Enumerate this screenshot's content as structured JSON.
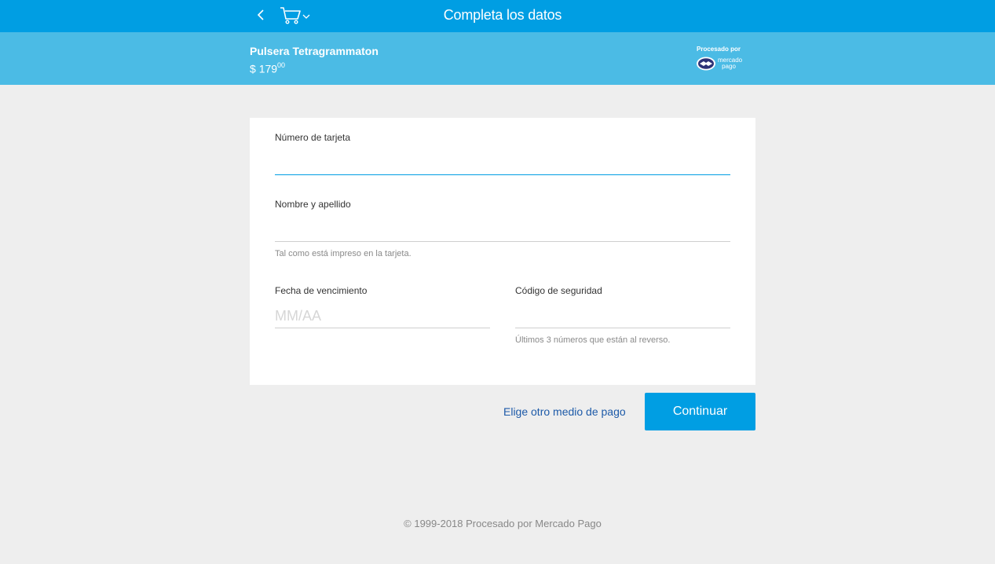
{
  "header": {
    "title": "Completa los datos",
    "back_icon": "chevron-left-icon",
    "cart_icon": "cart-icon",
    "background": "#009ee3"
  },
  "summary": {
    "product_name": "Pulsera Tetragrammaton",
    "price_symbol": "$",
    "price_integer": "179",
    "price_cents": "00",
    "processed_by": "Procesado por",
    "logo_line1": "mercado",
    "logo_line2": "pago",
    "background": "#4bbbe5"
  },
  "form": {
    "card_number": {
      "label": "Número de tarjeta",
      "value": "",
      "placeholder": ""
    },
    "name": {
      "label": "Nombre y apellido",
      "value": "",
      "placeholder": "",
      "hint": "Tal como está impreso en la tarjeta."
    },
    "expiry": {
      "label": "Fecha de vencimiento",
      "value": "",
      "placeholder": "MM/AA"
    },
    "cvv": {
      "label": "Código de seguridad",
      "value": "",
      "placeholder": "",
      "hint": "Últimos 3 números que están al reverso."
    }
  },
  "actions": {
    "alt_payment": "Elige otro medio de pago",
    "continue": "Continuar",
    "accent": "#009ee3",
    "link_color": "#1d5aa8"
  },
  "footer": {
    "copyright": "© 1999-2018 Procesado por Mercado Pago"
  }
}
